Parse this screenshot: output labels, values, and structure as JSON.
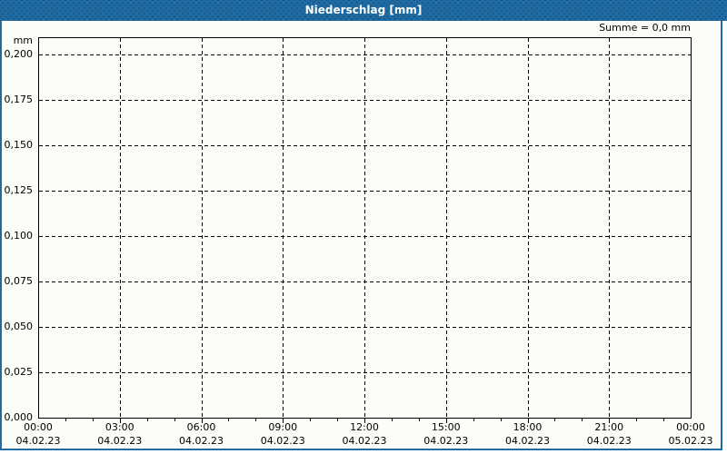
{
  "window": {
    "title": "Niederschlag [mm]",
    "summary": "Summe = 0,0 mm"
  },
  "colors": {
    "titlebar_blue": "#1E6CA3",
    "frame_blue": "#1E6CA3",
    "chart_background": "#FCFDF6",
    "grid_axis_black": "#000000",
    "title_text": "#FFFFFF"
  },
  "chart_data": {
    "type": "line",
    "title": "Niederschlag [mm]",
    "subtitle": "",
    "summary": "Summe = 0,0 mm",
    "ylabel_unit": "mm",
    "grid": true,
    "legend": "none",
    "y_axis": {
      "min": 0.0,
      "max": 0.209,
      "tick_step": 0.025,
      "tick_labels": [
        "0,000",
        "0,025",
        "0,050",
        "0,075",
        "0,100",
        "0,125",
        "0,150",
        "0,175",
        "0,200"
      ]
    },
    "x_axis": {
      "span_hours": 24,
      "minor_step_hours": 1,
      "major_step_hours": 3,
      "major_ticks": [
        {
          "time": "00:00",
          "date": "04.02.23"
        },
        {
          "time": "03:00",
          "date": "04.02.23"
        },
        {
          "time": "06:00",
          "date": "04.02.23"
        },
        {
          "time": "09:00",
          "date": "04.02.23"
        },
        {
          "time": "12:00",
          "date": "04.02.23"
        },
        {
          "time": "15:00",
          "date": "04.02.23"
        },
        {
          "time": "18:00",
          "date": "04.02.23"
        },
        {
          "time": "21:00",
          "date": "04.02.23"
        },
        {
          "time": "00:00",
          "date": "05.02.23"
        }
      ]
    },
    "series": [
      {
        "name": "Niederschlag",
        "unit": "mm",
        "sum_label": "0,0",
        "values": []
      }
    ]
  }
}
